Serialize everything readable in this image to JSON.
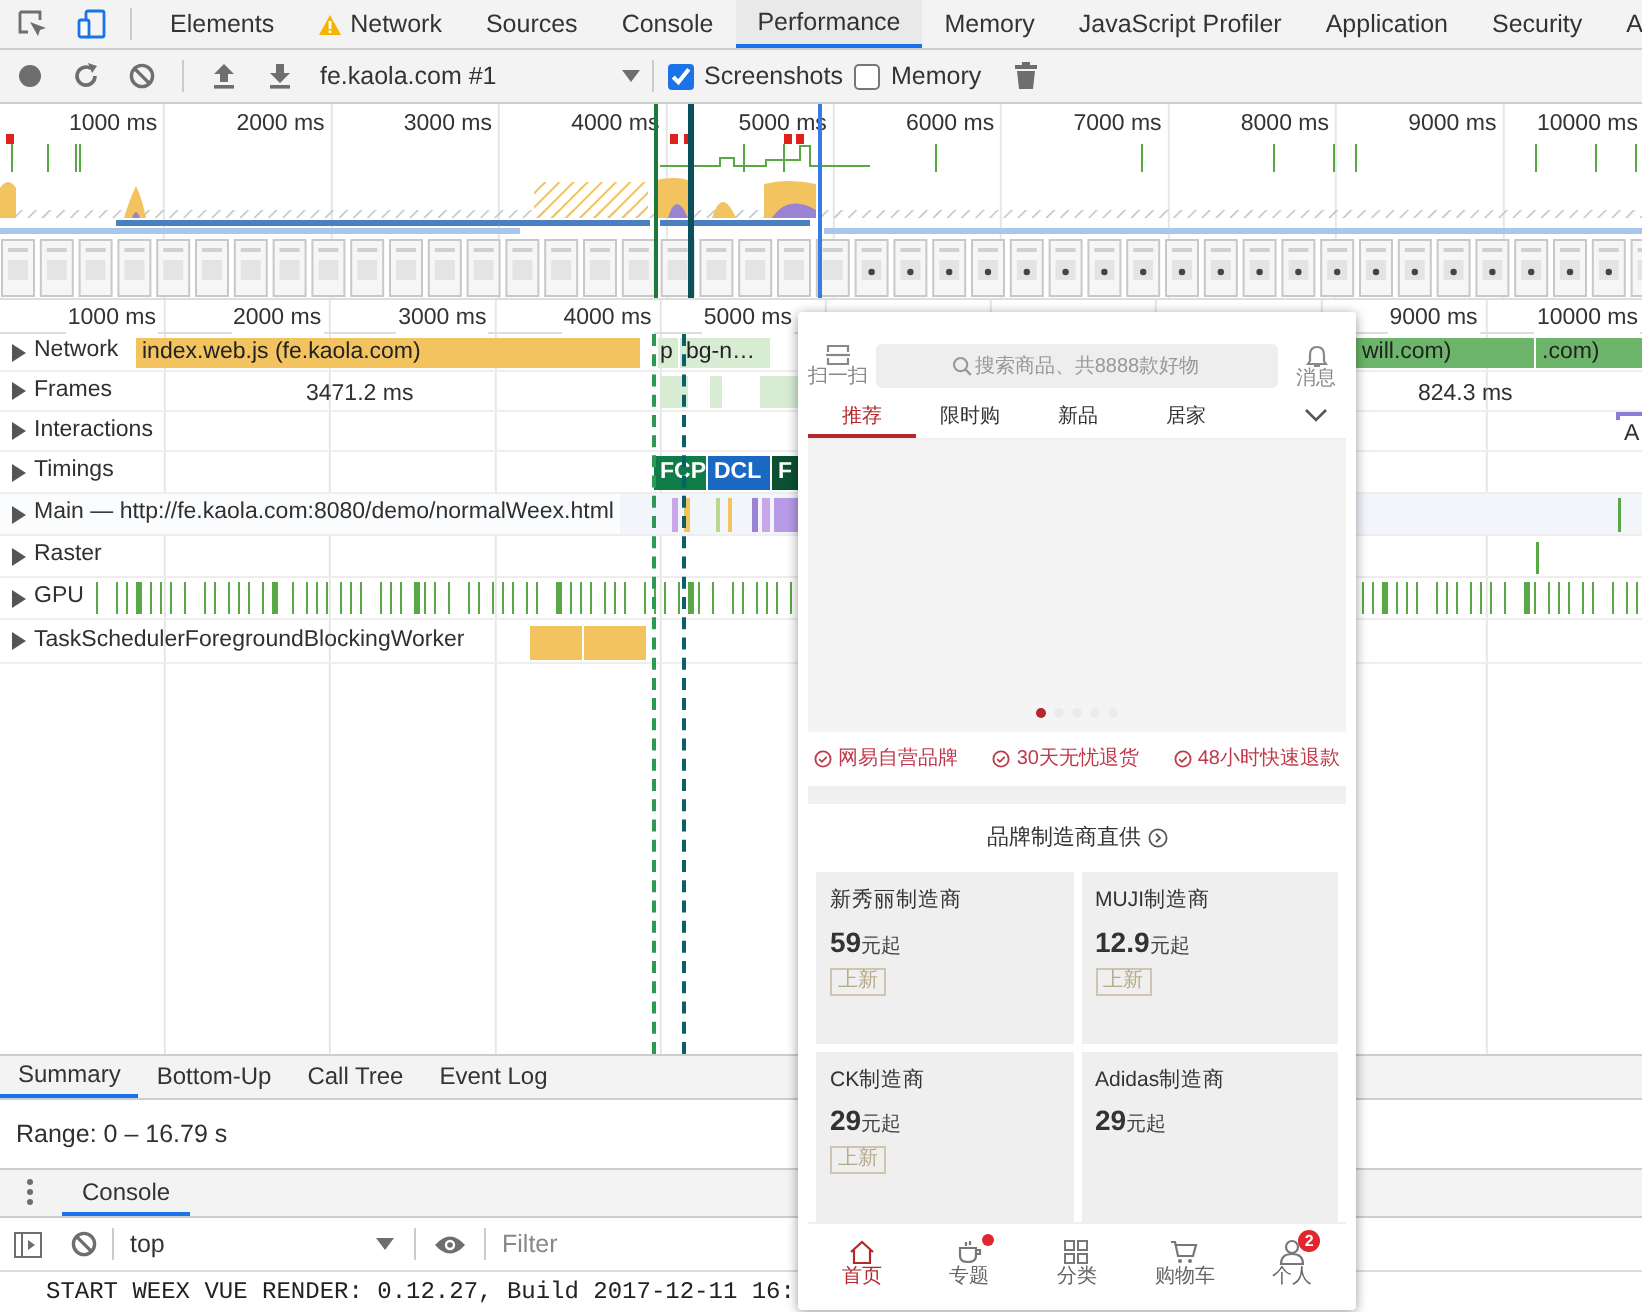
{
  "devtools_tabs": [
    {
      "label": "Elements",
      "warning": false,
      "selected": false
    },
    {
      "label": "Network",
      "warning": true,
      "selected": false
    },
    {
      "label": "Sources",
      "warning": false,
      "selected": false
    },
    {
      "label": "Console",
      "warning": false,
      "selected": false
    },
    {
      "label": "Performance",
      "warning": false,
      "selected": true
    },
    {
      "label": "Memory",
      "warning": false,
      "selected": false
    },
    {
      "label": "JavaScript Profiler",
      "warning": false,
      "selected": false
    },
    {
      "label": "Application",
      "warning": false,
      "selected": false
    },
    {
      "label": "Security",
      "warning": false,
      "selected": false
    },
    {
      "label": "A",
      "warning": false,
      "selected": false
    }
  ],
  "toolbar": {
    "profile": "fe.kaola.com #1",
    "options": [
      {
        "label": "Screenshots",
        "checked": true
      },
      {
        "label": "Memory",
        "checked": false
      }
    ]
  },
  "overview": {
    "ruler": [
      "1000 ms",
      "2000 ms",
      "3000 ms",
      "4000 ms",
      "5000 ms",
      "6000 ms",
      "7000 ms",
      "8000 ms",
      "9000 ms",
      "10000 ms"
    ]
  },
  "timeline": {
    "ruler": [
      "1000 ms",
      "2000 ms",
      "3000 ms",
      "4000 ms",
      "5000 ms",
      "9000 ms",
      "10000 ms"
    ],
    "tracks": [
      {
        "kind": "network",
        "label": "Network",
        "expanded": false,
        "items": [
          {
            "text": "index.web.js (fe.kaola.com)",
            "color": "#f2c35f"
          },
          {
            "text": "p",
            "color": "#d8ecd4"
          },
          {
            "text": "bg-n…",
            "color": "#d8ecd4"
          },
          {
            "text": "will.com)",
            "color": "#6cb56a"
          },
          {
            "text": ".com)",
            "color": "#6cb56a"
          }
        ]
      },
      {
        "kind": "frames",
        "label": "Frames",
        "expanded": false,
        "items": [
          {
            "text": "3471.2 ms"
          },
          {
            "text": "824.3 ms"
          }
        ]
      },
      {
        "kind": "interactions",
        "label": "Interactions",
        "expanded": false,
        "items": [
          {
            "text": "A"
          }
        ]
      },
      {
        "kind": "timings",
        "label": "Timings",
        "expanded": false,
        "items": [
          {
            "text": "FCP",
            "color": "#0f7c47"
          },
          {
            "text": "DCL",
            "color": "#1968c2"
          },
          {
            "text": "F",
            "color": "#0b5131"
          }
        ]
      },
      {
        "kind": "main",
        "label": "Main — http://fe.kaola.com:8080/demo/normalWeex.html",
        "expanded": false
      },
      {
        "kind": "raster",
        "label": "Raster",
        "expanded": false
      },
      {
        "kind": "gpu",
        "label": "GPU",
        "expanded": false
      },
      {
        "kind": "worker",
        "label": "TaskSchedulerForegroundBlockingWorker",
        "expanded": false
      }
    ]
  },
  "details_tabs": [
    {
      "label": "Summary",
      "selected": true
    },
    {
      "label": "Bottom-Up",
      "selected": false
    },
    {
      "label": "Call Tree",
      "selected": false
    },
    {
      "label": "Event Log",
      "selected": false
    }
  ],
  "range": "Range: 0 – 16.79 s",
  "drawer": {
    "tabs": [
      {
        "label": "Console",
        "selected": true
      }
    ],
    "context": "top",
    "filter_placeholder": "Filter",
    "messages": [
      "START WEEX VUE RENDER: 0.12.27, Build 2017-12-11 16:"
    ]
  },
  "screenshot_preview": {
    "scan_label": "扫一扫",
    "search_placeholder": "搜索商品、共8888款好物",
    "message_label": "消息",
    "categories": [
      {
        "label": "推荐",
        "selected": true
      },
      {
        "label": "限时购",
        "selected": false
      },
      {
        "label": "新品",
        "selected": false
      },
      {
        "label": "居家",
        "selected": false
      }
    ],
    "banner_dots": [
      {
        "selected": true
      },
      {
        "selected": false
      },
      {
        "selected": false
      },
      {
        "selected": false
      },
      {
        "selected": false
      }
    ],
    "promises": [
      "网易自营品牌",
      "30天无忧退货",
      "48小时快速退款"
    ],
    "section_title": "品牌制造商直供",
    "brands": [
      {
        "name": "新秀丽制造商",
        "price": "59",
        "unit": "元起",
        "tag": "上新"
      },
      {
        "name": "MUJI制造商",
        "price": "12.9",
        "unit": "元起",
        "tag": "上新"
      },
      {
        "name": "CK制造商",
        "price": "29",
        "unit": "元起",
        "tag": "上新"
      },
      {
        "name": "Adidas制造商",
        "price": "29",
        "unit": "元起"
      }
    ],
    "bottom_nav": [
      {
        "kind": "home",
        "label": "首页",
        "selected": true,
        "dot": false
      },
      {
        "kind": "topic",
        "label": "专题",
        "selected": false,
        "dot": true
      },
      {
        "kind": "category",
        "label": "分类",
        "selected": false,
        "dot": false
      },
      {
        "kind": "cart",
        "label": "购物车",
        "selected": false,
        "dot": false
      },
      {
        "kind": "person",
        "label": "个人",
        "selected": false,
        "dot": false,
        "badge": "2"
      }
    ]
  }
}
